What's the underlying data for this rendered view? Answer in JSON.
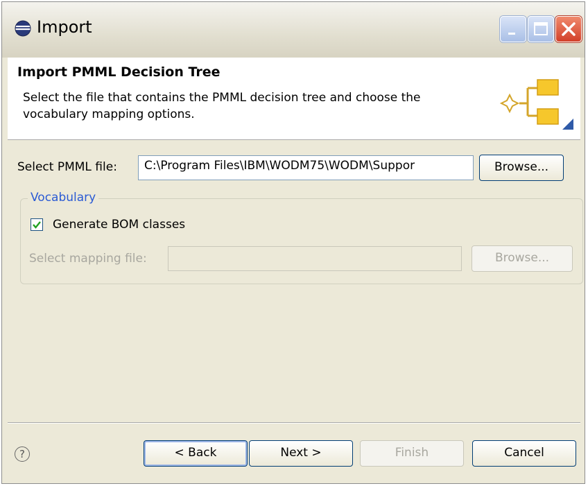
{
  "window": {
    "title": "Import"
  },
  "banner": {
    "title": "Import PMML Decision Tree",
    "description": "Select the file that contains the PMML decision tree and choose the vocabulary mapping options."
  },
  "pmml": {
    "label": "Select PMML file:",
    "value": "C:\\Program Files\\IBM\\WODM75\\WODM\\Suppor",
    "browse_label": "Browse..."
  },
  "vocabulary": {
    "legend": "Vocabulary",
    "generate_bom_label": "Generate BOM classes",
    "generate_bom_checked": true,
    "mapping_label": "Select mapping file:",
    "mapping_value": "",
    "mapping_browse_label": "Browse..."
  },
  "footer": {
    "help_symbol": "?",
    "back_label": "< Back",
    "next_label": "Next >",
    "finish_label": "Finish",
    "cancel_label": "Cancel"
  },
  "icons": {
    "window_icon": "eclipse-icon",
    "banner_icon": "decision-tree-icon"
  }
}
